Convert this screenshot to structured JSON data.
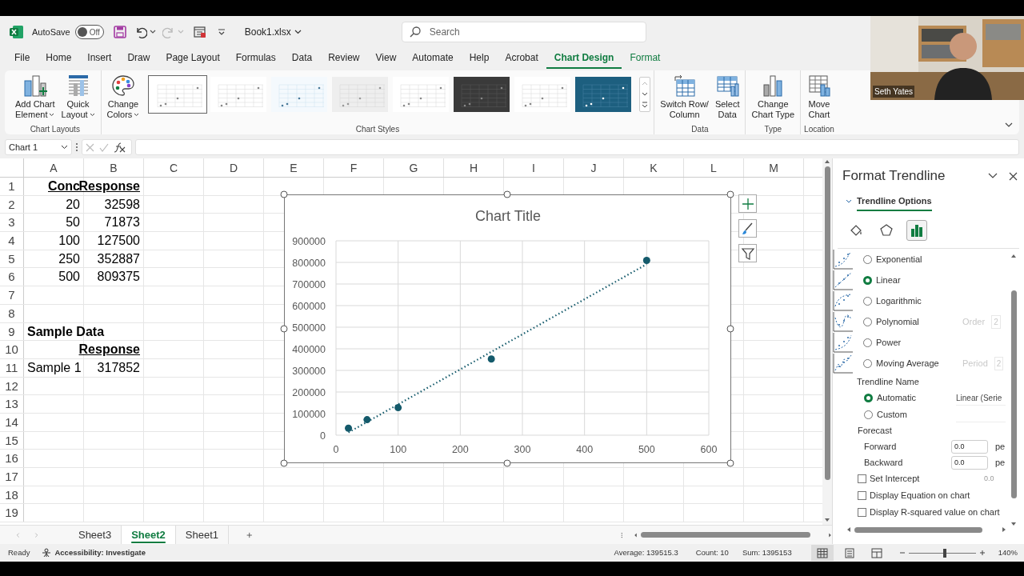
{
  "title_bar": {
    "autosave_label": "AutoSave",
    "autosave": {
      "label": "Off",
      "on": false
    },
    "file_name": "Book1.xlsx",
    "search": {
      "placeholder": "Search"
    }
  },
  "menu_tabs": [
    {
      "label": "File",
      "selected": false,
      "contextual": false
    },
    {
      "label": "Home",
      "selected": false,
      "contextual": false
    },
    {
      "label": "Insert",
      "selected": false,
      "contextual": false
    },
    {
      "label": "Draw",
      "selected": false,
      "contextual": false
    },
    {
      "label": "Page Layout",
      "selected": false,
      "contextual": false
    },
    {
      "label": "Formulas",
      "selected": false,
      "contextual": false
    },
    {
      "label": "Data",
      "selected": false,
      "contextual": false
    },
    {
      "label": "Review",
      "selected": false,
      "contextual": false
    },
    {
      "label": "View",
      "selected": false,
      "contextual": false
    },
    {
      "label": "Automate",
      "selected": false,
      "contextual": false
    },
    {
      "label": "Help",
      "selected": false,
      "contextual": false
    },
    {
      "label": "Acrobat",
      "selected": false,
      "contextual": false
    },
    {
      "label": "Chart Design",
      "selected": true,
      "contextual": true
    },
    {
      "label": "Format",
      "selected": false,
      "contextual": true
    }
  ],
  "ribbon": {
    "groups": [
      {
        "label": "Chart Layouts",
        "buttons": [
          {
            "lines": [
              "Add Chart",
              "Element"
            ],
            "dropdown": true
          },
          {
            "lines": [
              "Quick",
              "Layout"
            ],
            "dropdown": true
          }
        ]
      },
      {
        "label": "Chart Styles",
        "buttons": [
          {
            "lines": [
              "Change",
              "Colors"
            ],
            "dropdown": true
          }
        ],
        "gallery": [
          {
            "kind": "light",
            "selected": true
          },
          {
            "kind": "light",
            "selected": false
          },
          {
            "kind": "tinted",
            "selected": false
          },
          {
            "kind": "shaded",
            "selected": false
          },
          {
            "kind": "light",
            "selected": false
          },
          {
            "kind": "dark",
            "selected": false
          },
          {
            "kind": "light",
            "selected": false
          },
          {
            "kind": "blue",
            "selected": false
          }
        ]
      },
      {
        "label": "Data",
        "buttons": [
          {
            "lines": [
              "Switch Row/",
              "Column"
            ],
            "dropdown": false
          },
          {
            "lines": [
              "Select",
              "Data"
            ],
            "dropdown": false
          }
        ]
      },
      {
        "label": "Type",
        "buttons": [
          {
            "lines": [
              "Change",
              "Chart Type"
            ],
            "dropdown": false
          }
        ]
      },
      {
        "label": "Location",
        "buttons": [
          {
            "lines": [
              "Move",
              "Chart"
            ],
            "dropdown": false
          }
        ]
      }
    ]
  },
  "webcam": {
    "caption": "Seth Yates"
  },
  "formula_bar": {
    "name_box": "Chart 1"
  },
  "sheet": {
    "columns": [
      "A",
      "B",
      "C",
      "D",
      "E",
      "F",
      "G",
      "H",
      "I",
      "J",
      "K",
      "L",
      "M"
    ],
    "rows": [
      {
        "number": "1",
        "a": {
          "text": "Conc",
          "kind": "header"
        },
        "b": {
          "text": "Response",
          "kind": "header"
        }
      },
      {
        "number": "2",
        "a": {
          "text": "20",
          "kind": "number"
        },
        "b": {
          "text": "32598",
          "kind": "number"
        }
      },
      {
        "number": "3",
        "a": {
          "text": "50",
          "kind": "number"
        },
        "b": {
          "text": "71873",
          "kind": "number"
        }
      },
      {
        "number": "4",
        "a": {
          "text": "100",
          "kind": "number"
        },
        "b": {
          "text": "127500",
          "kind": "number"
        }
      },
      {
        "number": "5",
        "a": {
          "text": "250",
          "kind": "number"
        },
        "b": {
          "text": "352887",
          "kind": "number"
        }
      },
      {
        "number": "6",
        "a": {
          "text": "500",
          "kind": "number"
        },
        "b": {
          "text": "809375",
          "kind": "number"
        }
      },
      {
        "number": "7"
      },
      {
        "number": "8"
      },
      {
        "number": "9",
        "a": {
          "text": "Sample Data",
          "kind": "title"
        }
      },
      {
        "number": "10",
        "b": {
          "text": "Response",
          "kind": "header"
        }
      },
      {
        "number": "11",
        "a": {
          "text": "Sample 1",
          "kind": "label"
        },
        "b": {
          "text": "317852",
          "kind": "number"
        }
      },
      {
        "number": "12"
      },
      {
        "number": "13"
      },
      {
        "number": "14"
      },
      {
        "number": "15"
      },
      {
        "number": "16"
      },
      {
        "number": "17"
      },
      {
        "number": "18"
      },
      {
        "number": "19"
      }
    ]
  },
  "chart": {
    "selected": true,
    "chart_data": {
      "type": "scatter",
      "title": "Chart Title",
      "x": [
        20,
        50,
        100,
        250,
        500
      ],
      "series": [
        {
          "color": "#145a6b",
          "values": [
            32598,
            71873,
            127500,
            352887,
            809375
          ]
        },
        {
          "type": "line",
          "line_style": "dotted",
          "color": "#145a6b",
          "values": [
            12691,
            61378,
            142523,
            385958,
            791683
          ]
        }
      ],
      "xlim": [
        0,
        600
      ],
      "ylim": [
        0,
        900000
      ],
      "xticks": [
        0,
        100,
        200,
        300,
        400,
        500,
        600
      ],
      "yticks": [
        0,
        100000,
        200000,
        300000,
        400000,
        500000,
        600000,
        700000,
        800000,
        900000
      ],
      "grid": true
    }
  },
  "sheet_tabs": [
    {
      "label": "Sheet3",
      "selected": false
    },
    {
      "label": "Sheet2",
      "selected": true
    },
    {
      "label": "Sheet1",
      "selected": false
    }
  ],
  "format_pane": {
    "title": "Format Trendline",
    "section": {
      "label": "Trendline Options",
      "expanded": true
    },
    "icon_tabs": [
      {
        "selected": false
      },
      {
        "selected": false
      },
      {
        "selected": true
      }
    ],
    "trendline_types": [
      {
        "label": "Exponential",
        "selected": false
      },
      {
        "label": "Linear",
        "selected": true
      },
      {
        "label": "Logarithmic",
        "selected": false
      },
      {
        "label": "Polynomial",
        "selected": false,
        "option_label": "Order",
        "option_value": "2"
      },
      {
        "label": "Power",
        "selected": false
      },
      {
        "label": "Moving Average",
        "selected": false,
        "option_label": "Period",
        "option_value": "2"
      }
    ],
    "name_heading": "Trendline Name",
    "name_options": [
      {
        "label": "Automatic",
        "selected": true,
        "value": "Linear (Serie"
      },
      {
        "label": "Custom",
        "selected": false
      }
    ],
    "forecast_heading": "Forecast",
    "forecast": [
      {
        "label": "Forward",
        "value": "0.0",
        "unit": "pe"
      },
      {
        "label": "Backward",
        "value": "0.0",
        "unit": "pe"
      }
    ],
    "checkboxes": [
      {
        "label": "Set Intercept",
        "checked": false,
        "value": "0.0"
      },
      {
        "label": "Display Equation on chart",
        "checked": false
      },
      {
        "label": "Display R-squared value on chart",
        "checked": false
      }
    ]
  },
  "status_bar": {
    "mode": "Ready",
    "accessibility": "Accessibility: Investigate",
    "average": "Average: 139515.3",
    "count": "Count: 10",
    "sum": "Sum: 1395153",
    "views": [
      {
        "selected": true
      },
      {
        "selected": false
      },
      {
        "selected": false
      }
    ],
    "zoom": {
      "level": 0.54,
      "label": "140%"
    }
  }
}
